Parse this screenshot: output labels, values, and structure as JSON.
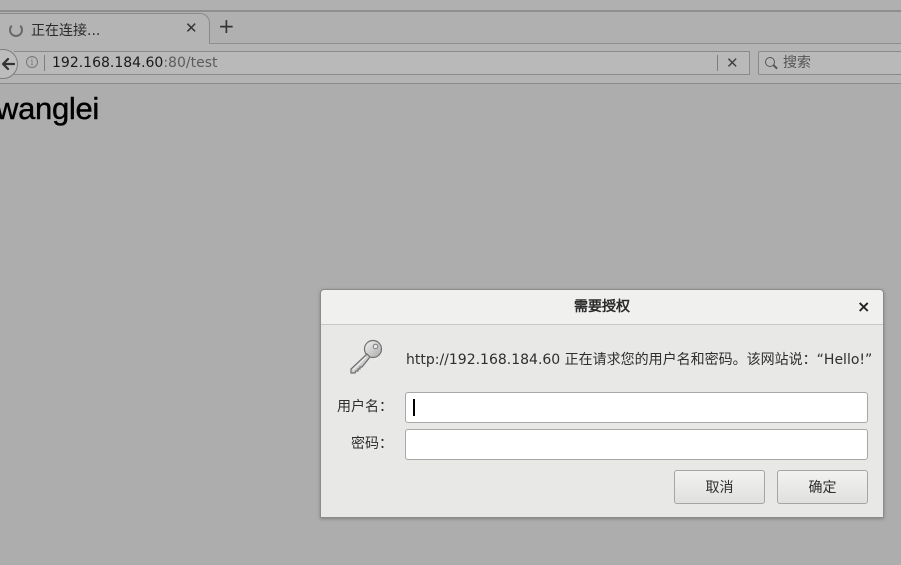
{
  "browser": {
    "tab": {
      "title": "正在连接...",
      "loading_icon": "spinner-icon",
      "close_glyph": "✕"
    },
    "new_tab_glyph": "+",
    "nav": {
      "back_glyph": "🡐",
      "url_host": "192.168.184.60",
      "url_path": ":80/test",
      "info_glyph": "i",
      "stop_glyph": "✕",
      "search_placeholder": "搜索"
    }
  },
  "page": {
    "heading": "wanglei"
  },
  "auth_dialog": {
    "title": "需要授权",
    "close_glyph": "×",
    "icon": "key-icon",
    "message": "http://192.168.184.60 正在请求您的用户名和密码。该网站说：“Hello!”",
    "username_label": "用户名：",
    "username_value": "",
    "password_label": "密码：",
    "password_value": "",
    "cancel_label": "取消",
    "ok_label": "确定"
  },
  "colors": {
    "page_background": "#adadad",
    "dialog_background": "#e8e8e7",
    "dialog_titlebar": "#f0f0ef"
  }
}
